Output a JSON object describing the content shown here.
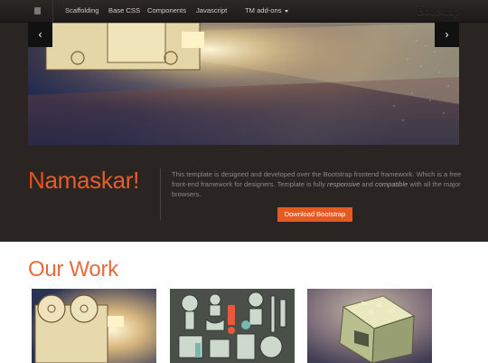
{
  "navbar": {
    "items": [
      {
        "label": "Scaffolding"
      },
      {
        "label": "Base CSS"
      },
      {
        "label": "Components"
      },
      {
        "label": "Javascript"
      },
      {
        "label": "TM add-ons"
      }
    ],
    "brand": "Bootstrap",
    "icons": [
      "home-icon",
      "chevron-down-icon"
    ]
  },
  "slider": {
    "icons": [
      "chevron-left-icon",
      "chevron-right-icon"
    ],
    "prev_glyph": "‹",
    "next_glyph": "›"
  },
  "hero": {
    "title_first": "N",
    "title_rest": "amaskar!",
    "text_start": "This template is designed and developed over the Bootstrap frontend framework. Which is a free front-end framework for designers. Template is fully ",
    "text_em1": "responsive",
    "text_mid": " and ",
    "text_em2": "compatible",
    "text_end": " with all the major browsers.",
    "button_label": "Download Bootstrap"
  },
  "work": {
    "title": "Our Work"
  },
  "colors": {
    "accent": "#e55a22",
    "navbar": "#221e1c",
    "hero_bg": "#2a2523",
    "text_muted": "#8f8884"
  }
}
